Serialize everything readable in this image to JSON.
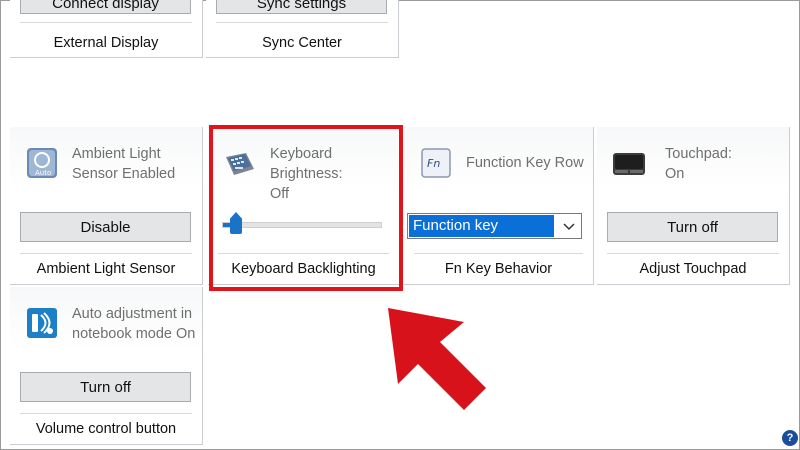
{
  "top_tiles": [
    {
      "button": "Connect display",
      "caption": "External Display"
    },
    {
      "button": "Sync settings",
      "caption": "Sync Center"
    }
  ],
  "ambient": {
    "status": "Ambient Light Sensor Enabled",
    "button": "Disable",
    "caption": "Ambient Light Sensor"
  },
  "keyboard": {
    "status_line1": "Keyboard",
    "status_line2": "Brightness:",
    "status_line3": "Off",
    "brightness_level": 0.05,
    "caption": "Keyboard Backlighting"
  },
  "fn": {
    "status": "Function Key Row",
    "icon_text": "Fn",
    "selected": "Function key",
    "caption": "Fn Key Behavior"
  },
  "touchpad": {
    "status_line1": "Touchpad:",
    "status_line2": "On",
    "button": "Turn off",
    "caption": "Adjust Touchpad"
  },
  "volume": {
    "status": "Auto adjustment in notebook mode On",
    "button": "Turn off",
    "caption": "Volume control button"
  },
  "help": {
    "label": "?"
  },
  "colors": {
    "accent": "#1a73c8",
    "highlight": "#e2141b",
    "select_bg": "#0a6fd6"
  }
}
